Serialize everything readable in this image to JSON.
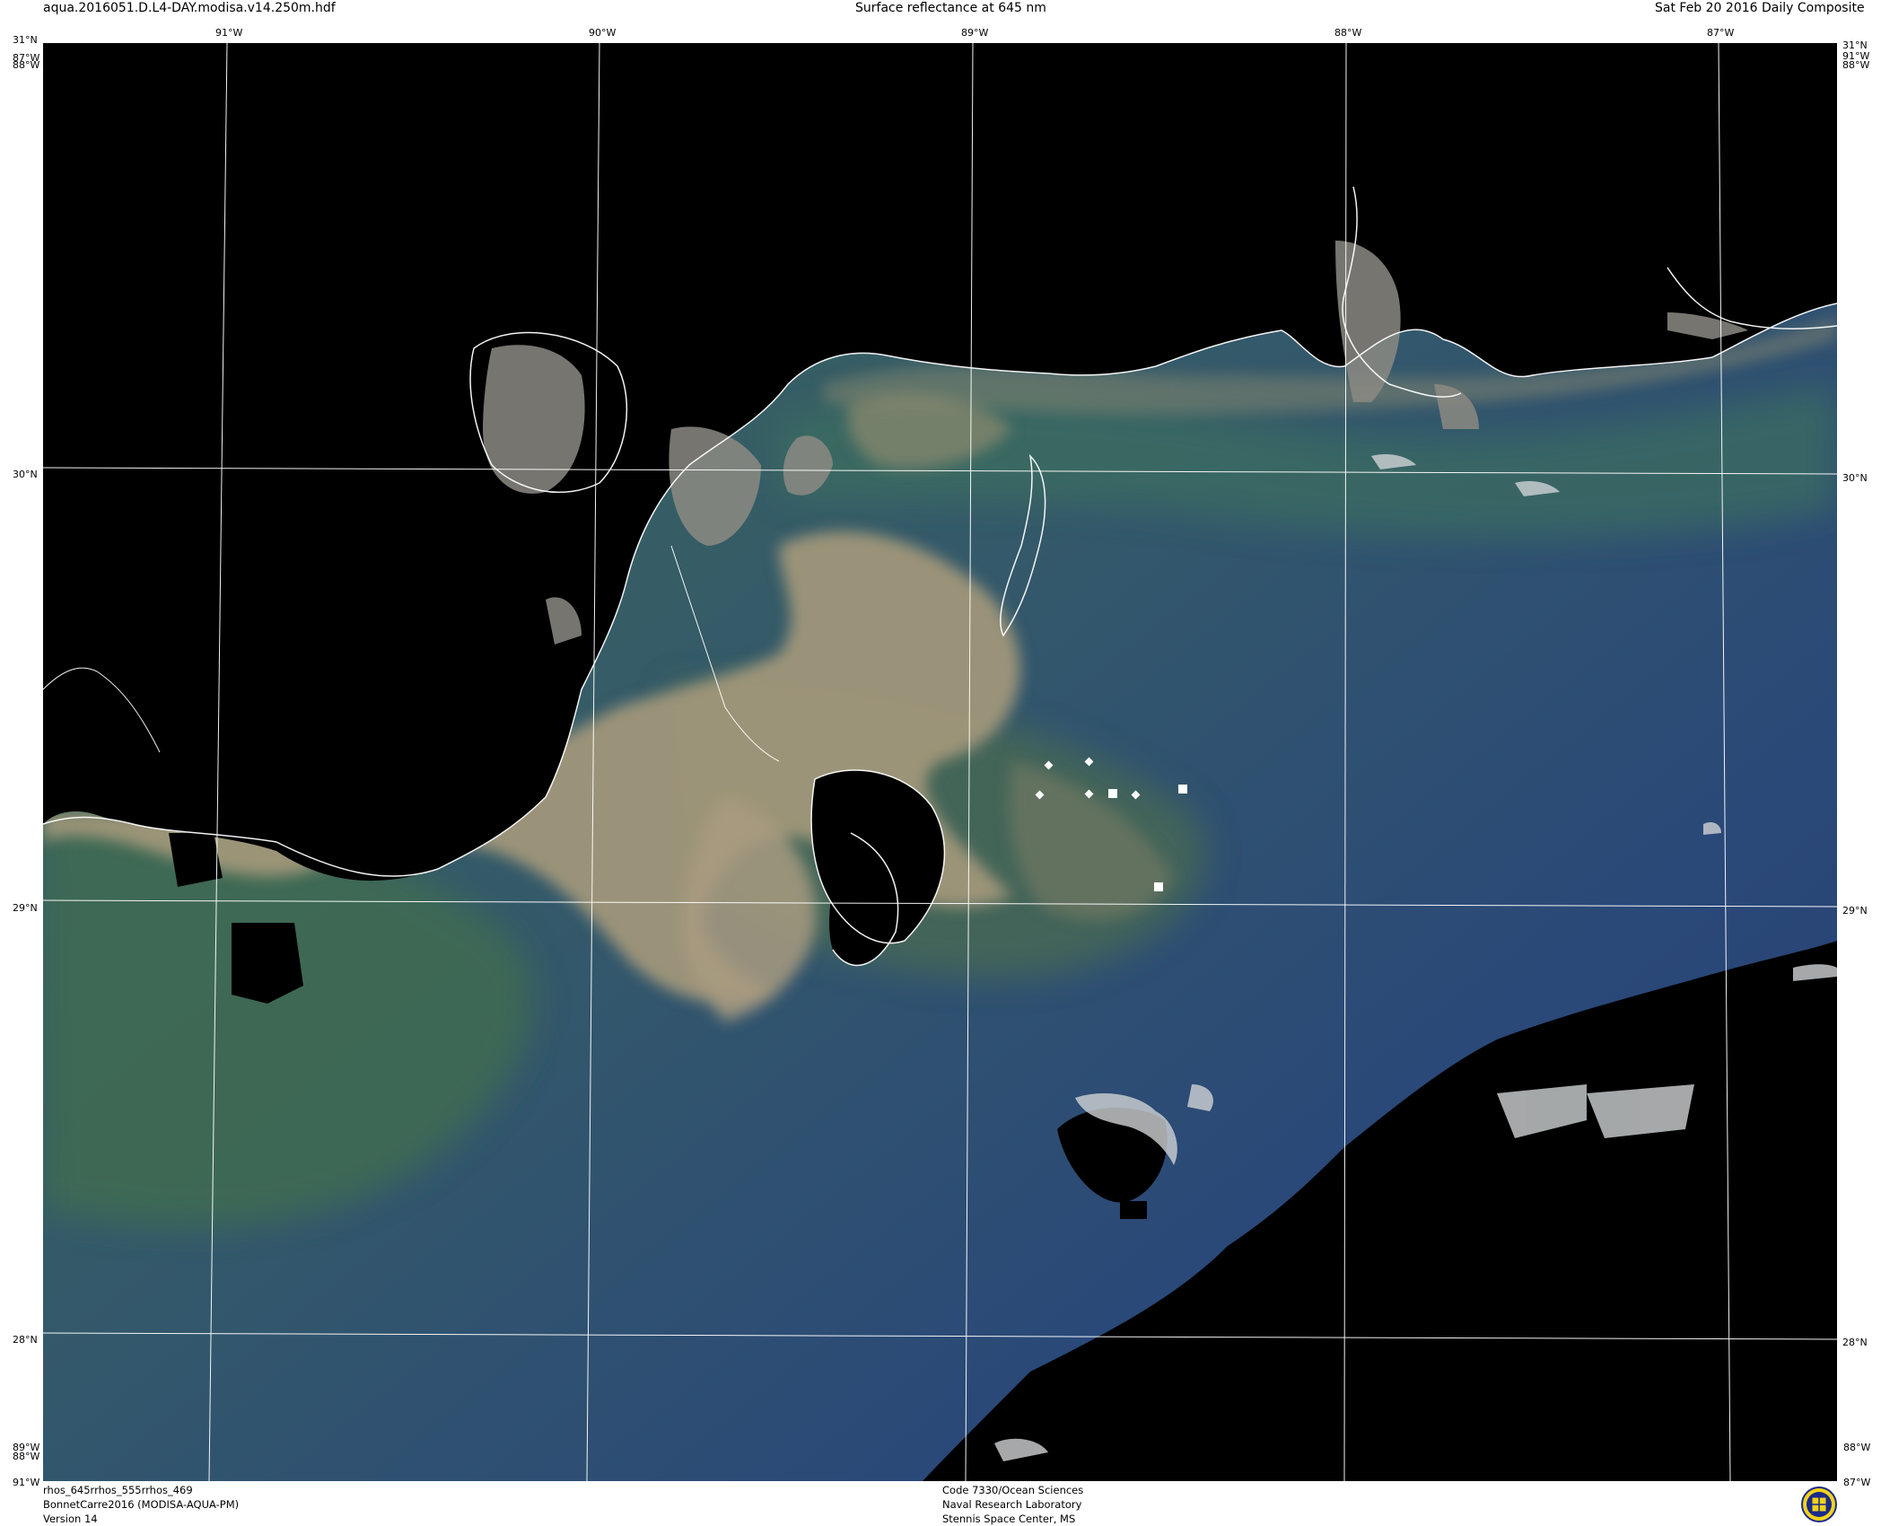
{
  "header": {
    "filename": "aqua.2016051.D.L4-DAY.modisa.v14.250m.hdf",
    "title": "Surface reflectance at 645 nm",
    "date": "Sat Feb 20 2016 Daily Composite"
  },
  "footer_left": {
    "bands": "rhos_645rrhos_555rrhos_469",
    "dataset": "BonnetCarre2016 (MODISA-AQUA-PM)",
    "version": "Version 14"
  },
  "footer_center": {
    "code": "Code 7330/Ocean Sciences",
    "lab": "Naval Research Laboratory",
    "place": "Stennis Space Center, MS"
  },
  "map": {
    "top_lon_labels": [
      "91°W",
      "90°W",
      "89°W",
      "88°W",
      "87°W"
    ],
    "left_lat_labels": [
      "31°N",
      "30°N",
      "29°N",
      "28°N"
    ],
    "right_lat_labels": [
      "31°N",
      "30°N",
      "29°N",
      "28°N"
    ],
    "corner_labels": {
      "top_left_lat": "31°N",
      "top_left_lon": "87°W",
      "top_left_lon2": "88°W",
      "top_right_lat": "31°N",
      "top_right_lon": "91°W",
      "top_right_lon2": "88°W",
      "bottom_left_lon": "89°W",
      "bottom_left_lon2": "88°W",
      "bottom_left_corner": "91°W",
      "bottom_right_lon": "88°W",
      "bottom_right_corner": "87°W"
    },
    "colors": {
      "land": "#000000",
      "sediment_plume": "#a89b7f",
      "green_water": "#3f6856",
      "deep_water": "#28467a",
      "graticule": "#ffffff",
      "coastline": "#ffffff"
    },
    "stations": [
      {
        "shape": "diamond"
      },
      {
        "shape": "diamond"
      },
      {
        "shape": "diamond"
      },
      {
        "shape": "diamond"
      },
      {
        "shape": "diamond"
      },
      {
        "shape": "square"
      },
      {
        "shape": "square"
      },
      {
        "shape": "square"
      }
    ]
  },
  "logo": {
    "icon": "nrl-seal-icon"
  }
}
